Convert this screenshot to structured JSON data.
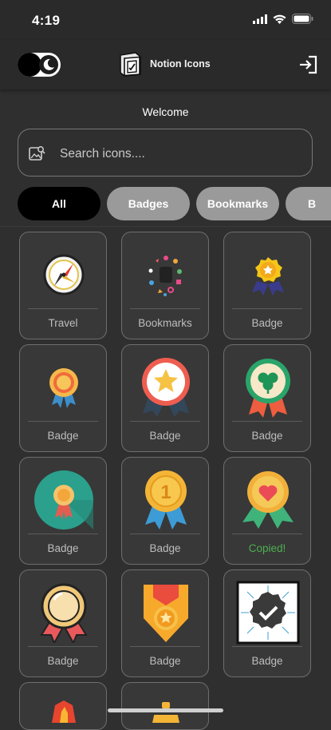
{
  "status": {
    "time": "4:19"
  },
  "header": {
    "title": "Notion Icons"
  },
  "welcome": "Welcome",
  "search": {
    "placeholder": "Search icons...."
  },
  "filters": [
    "All",
    "Badges",
    "Bookmarks",
    "B"
  ],
  "cards": [
    {
      "label": "Travel",
      "icon": "compass-icon"
    },
    {
      "label": "Bookmarks",
      "icon": "bookmarks-shapes-icon"
    },
    {
      "label": "Badge",
      "icon": "star-medal-icon"
    },
    {
      "label": "Badge",
      "icon": "rosette-ribbon-icon"
    },
    {
      "label": "Badge",
      "icon": "star-rosette-icon"
    },
    {
      "label": "Badge",
      "icon": "clover-medal-icon"
    },
    {
      "label": "Badge",
      "icon": "teal-circle-medal-icon"
    },
    {
      "label": "Badge",
      "icon": "number-one-medal-icon"
    },
    {
      "label": "Copied!",
      "icon": "heart-medal-icon"
    },
    {
      "label": "Badge",
      "icon": "gold-medal-icon"
    },
    {
      "label": "Badge",
      "icon": "shield-star-medal-icon"
    },
    {
      "label": "Badge",
      "icon": "check-badge-icon"
    }
  ],
  "colors": {
    "background": "#2f2f2f",
    "copied": "#4caf50",
    "chip_inactive": "#9a9a9a"
  }
}
